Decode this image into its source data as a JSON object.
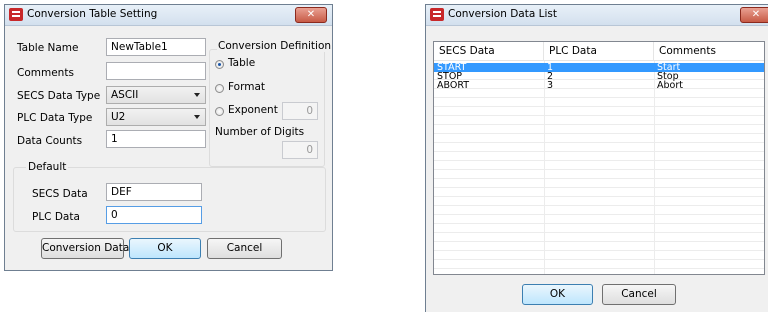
{
  "dialog_setting": {
    "title": "Conversion Table Setting",
    "close_glyph": "✕",
    "table_name_label": "Table Name",
    "table_name_value": "NewTable1",
    "comments_label": "Comments",
    "comments_value": "",
    "secs_type_label": "SECS Data Type",
    "secs_type_value": "ASCII",
    "plc_type_label": "PLC Data Type",
    "plc_type_value": "U2",
    "data_counts_label": "Data Counts",
    "data_counts_value": "1",
    "conv_def_label": "Conversion Definition",
    "radio_table": "Table",
    "radio_format": "Format",
    "radio_exponent": "Exponent",
    "exponent_value": "0",
    "digits_label": "Number of Digits",
    "digits_value": "0",
    "default_label": "Default",
    "default_secs_label": "SECS Data",
    "default_secs_value": "DEF",
    "default_plc_label": "PLC Data",
    "default_plc_value": "0",
    "btn_conversion": "Conversion Data",
    "btn_ok": "OK",
    "btn_cancel": "Cancel",
    "selected_radio": "table"
  },
  "dialog_list": {
    "title": "Conversion Data List",
    "close_glyph": "✕",
    "columns": [
      "SECS Data",
      "PLC Data",
      "Comments"
    ],
    "rows": [
      [
        "START",
        "1",
        "Start"
      ],
      [
        "STOP",
        "2",
        "Stop"
      ],
      [
        "ABORT",
        "3",
        "Abort"
      ]
    ],
    "selected_row": 0,
    "btn_ok": "OK",
    "btn_cancel": "Cancel"
  },
  "icons": {
    "app": "app-icon",
    "close": "close-icon",
    "dropdown": "chevron-down-icon"
  },
  "colors": {
    "close_button": "#c75b46",
    "selection": "#3399ff",
    "titlebar": "#d3e0ee"
  }
}
